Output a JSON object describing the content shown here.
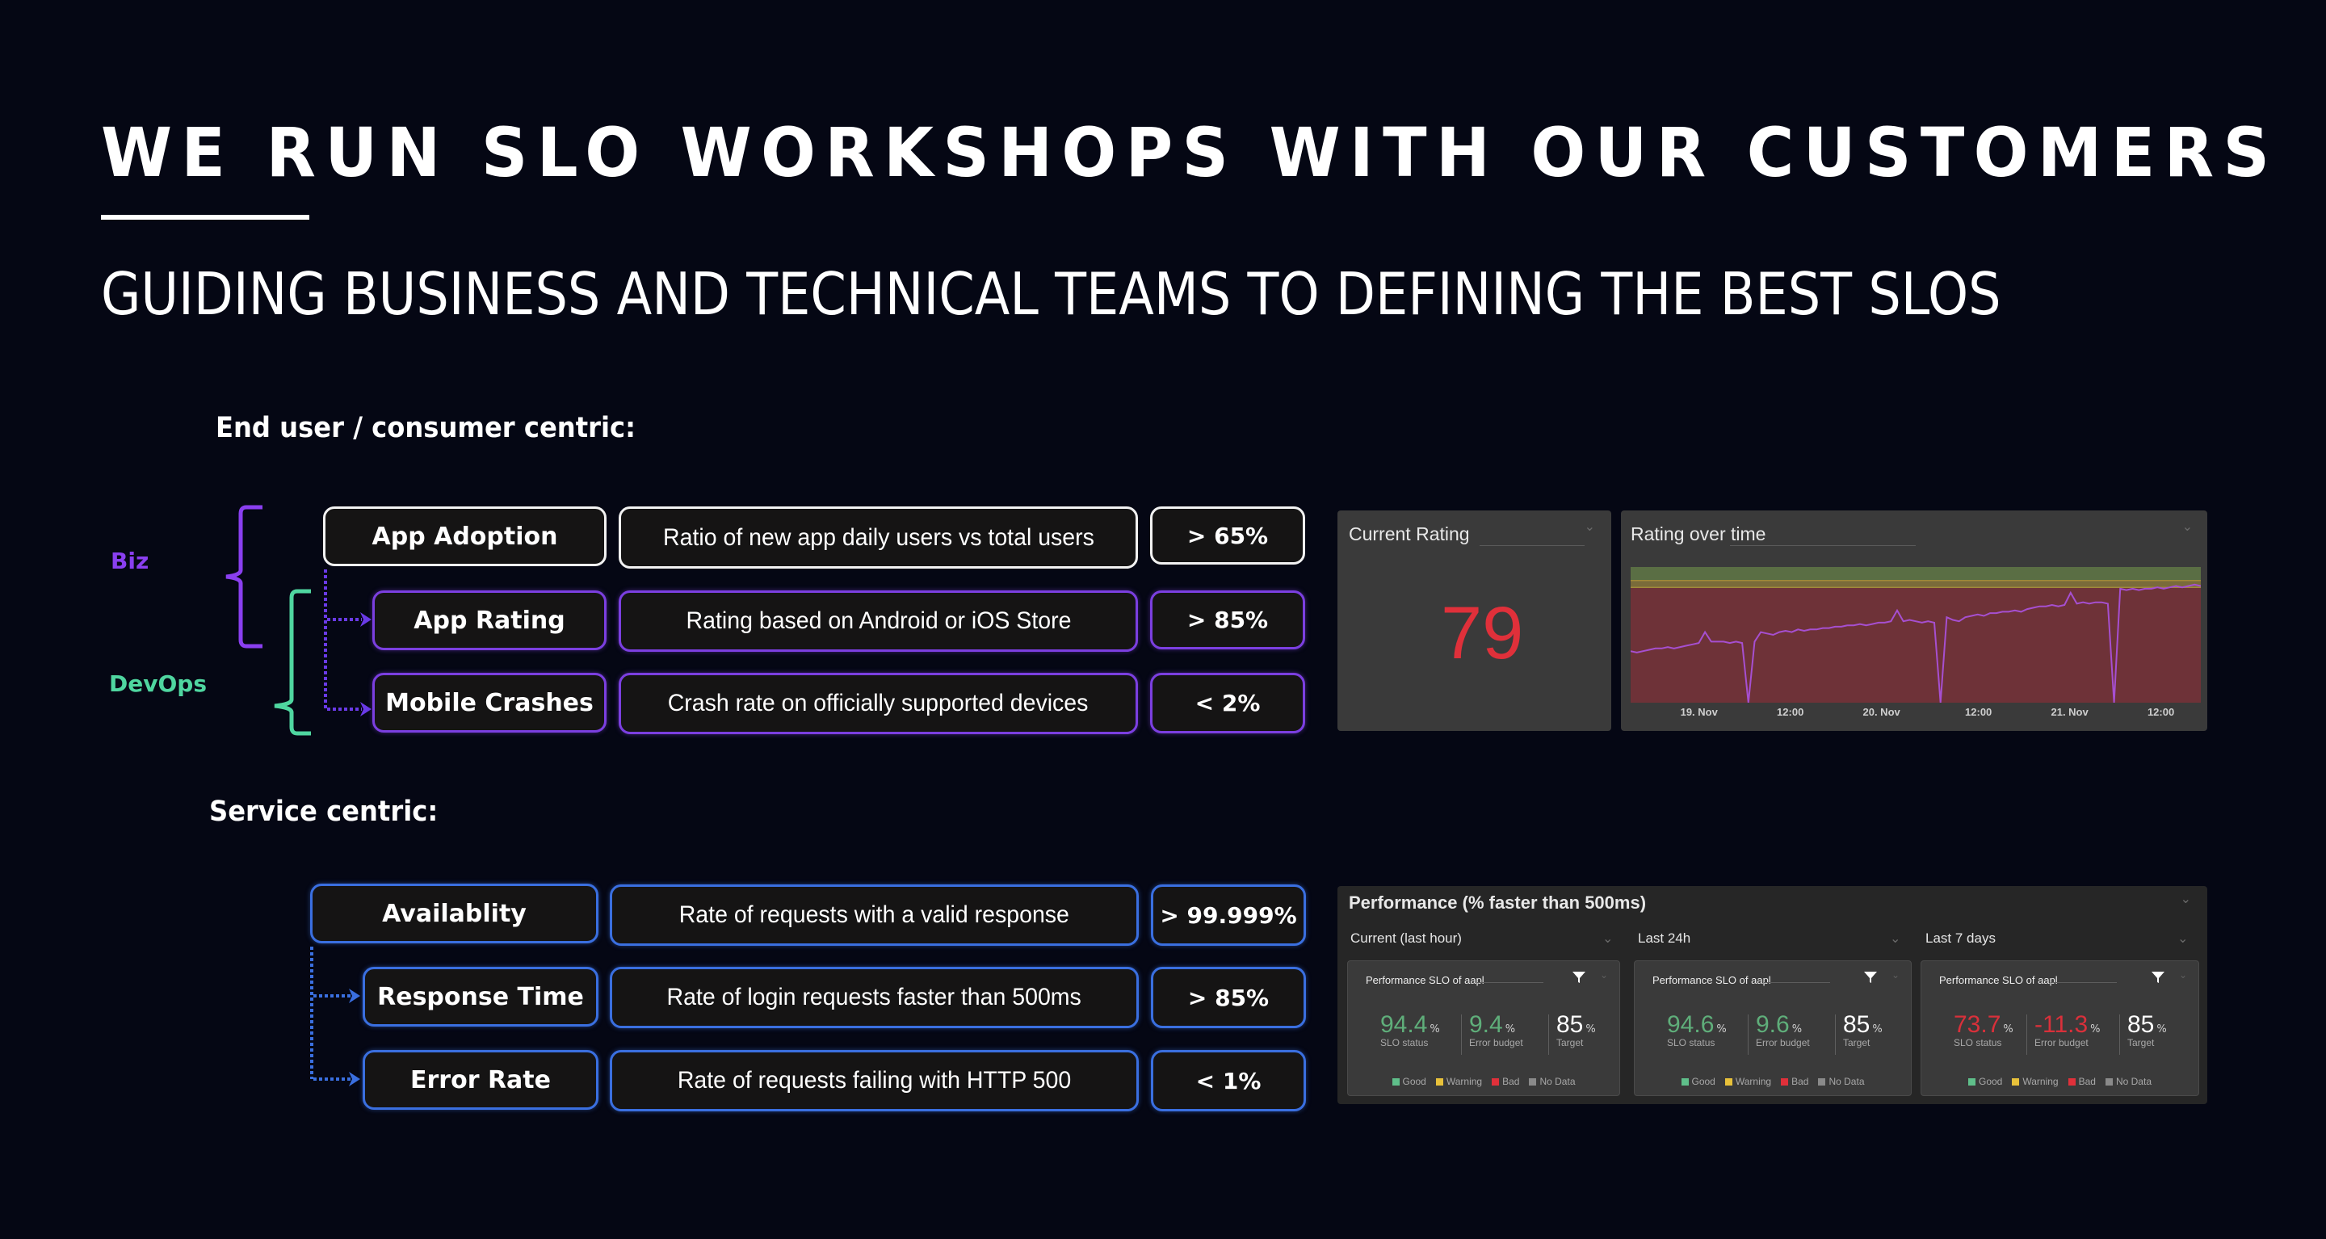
{
  "header": {
    "title": "WE RUN SLO WORKSHOPS WITH OUR CUSTOMERS",
    "subtitle": "GUIDING BUSINESS AND TECHNICAL TEAMS TO DEFINING THE BEST SLOS"
  },
  "end_user_section": {
    "label": "End user / consumer centric:",
    "groups": {
      "biz": "Biz",
      "devops": "DevOps"
    },
    "rows": [
      {
        "name": "App Adoption",
        "description": "Ratio of new app daily users vs total users",
        "target": "> 65%"
      },
      {
        "name": "App Rating",
        "description": "Rating based on Android or iOS Store",
        "target": "> 85%"
      },
      {
        "name": "Mobile Crashes",
        "description": "Crash rate on officially supported devices",
        "target": "< 2%"
      }
    ]
  },
  "service_section": {
    "label": "Service centric:",
    "rows": [
      {
        "name": "Availablity",
        "description": "Rate of requests with a valid response",
        "target": "> 99.999%"
      },
      {
        "name": "Response Time",
        "description": "Rate of login requests faster than 500ms",
        "target": "> 85%"
      },
      {
        "name": "Error Rate",
        "description": "Rate of requests failing with HTTP 500",
        "target": "< 1%"
      }
    ]
  },
  "current_rating_panel": {
    "title": "Current Rating",
    "value": "79",
    "value_color": "#e0303a"
  },
  "rating_over_time_panel": {
    "title": "Rating over time",
    "x_ticks": [
      "19. Nov",
      "12:00",
      "20. Nov",
      "12:00",
      "21. Nov",
      "12:00"
    ]
  },
  "performance_panel": {
    "title": "Performance (% faster than 500ms)",
    "columns": [
      {
        "title": "Current (last hour)",
        "card_title": "Performance SLO of aapl",
        "slo_status": "94.4",
        "error_budget": "9.4",
        "target": "85",
        "status_color": "#5fae7a"
      },
      {
        "title": "Last 24h",
        "card_title": "Performance SLO of aapl",
        "slo_status": "94.6",
        "error_budget": "9.6",
        "target": "85",
        "status_color": "#5fae7a"
      },
      {
        "title": "Last 7 days",
        "card_title": "Performance SLO of aapl",
        "slo_status": "73.7",
        "error_budget": "-11.3",
        "target": "85",
        "status_color": "#d9303a"
      }
    ],
    "metric_labels": {
      "slo_status": "SLO status",
      "error_budget": "Error budget",
      "target": "Target",
      "unit": "%"
    },
    "legend": [
      {
        "label": "Good",
        "color": "#5fbf8a"
      },
      {
        "label": "Warning",
        "color": "#e8c13a"
      },
      {
        "label": "Bad",
        "color": "#e0303a"
      },
      {
        "label": "No Data",
        "color": "#8a8a8a"
      }
    ]
  },
  "chart_data": {
    "type": "line",
    "title": "Rating over time",
    "xlabel": "",
    "ylabel": "",
    "x_tick_labels": [
      "19. Nov",
      "12:00",
      "20. Nov",
      "12:00",
      "21. Nov",
      "12:00"
    ],
    "ylim": [
      0,
      100
    ],
    "bands": [
      {
        "name": "good",
        "from": 90,
        "to": 100,
        "color": "#5a6e44"
      },
      {
        "name": "warning",
        "from": 85,
        "to": 90,
        "color": "#7a6b3a"
      },
      {
        "name": "bad",
        "from": 0,
        "to": 85,
        "color": "#6e3238"
      }
    ],
    "series": [
      {
        "name": "Rating",
        "color": "#a64fd0",
        "values": [
          38,
          37,
          38,
          39,
          40,
          40,
          41,
          40,
          41,
          42,
          43,
          44,
          52,
          45,
          45,
          45,
          44,
          45,
          44,
          0,
          45,
          52,
          51,
          50,
          52,
          53,
          52,
          54,
          53,
          54,
          54,
          55,
          55,
          56,
          56,
          57,
          57,
          58,
          57,
          58,
          59,
          59,
          60,
          68,
          60,
          61,
          60,
          59,
          60,
          59,
          0,
          63,
          61,
          60,
          63,
          64,
          65,
          64,
          66,
          66,
          67,
          67,
          68,
          67,
          69,
          70,
          71,
          71,
          72,
          71,
          72,
          81,
          73,
          74,
          73,
          74,
          74,
          73,
          0,
          84,
          83,
          84,
          83,
          84,
          84,
          85,
          84,
          85,
          86,
          85,
          86,
          87,
          86
        ]
      }
    ]
  }
}
